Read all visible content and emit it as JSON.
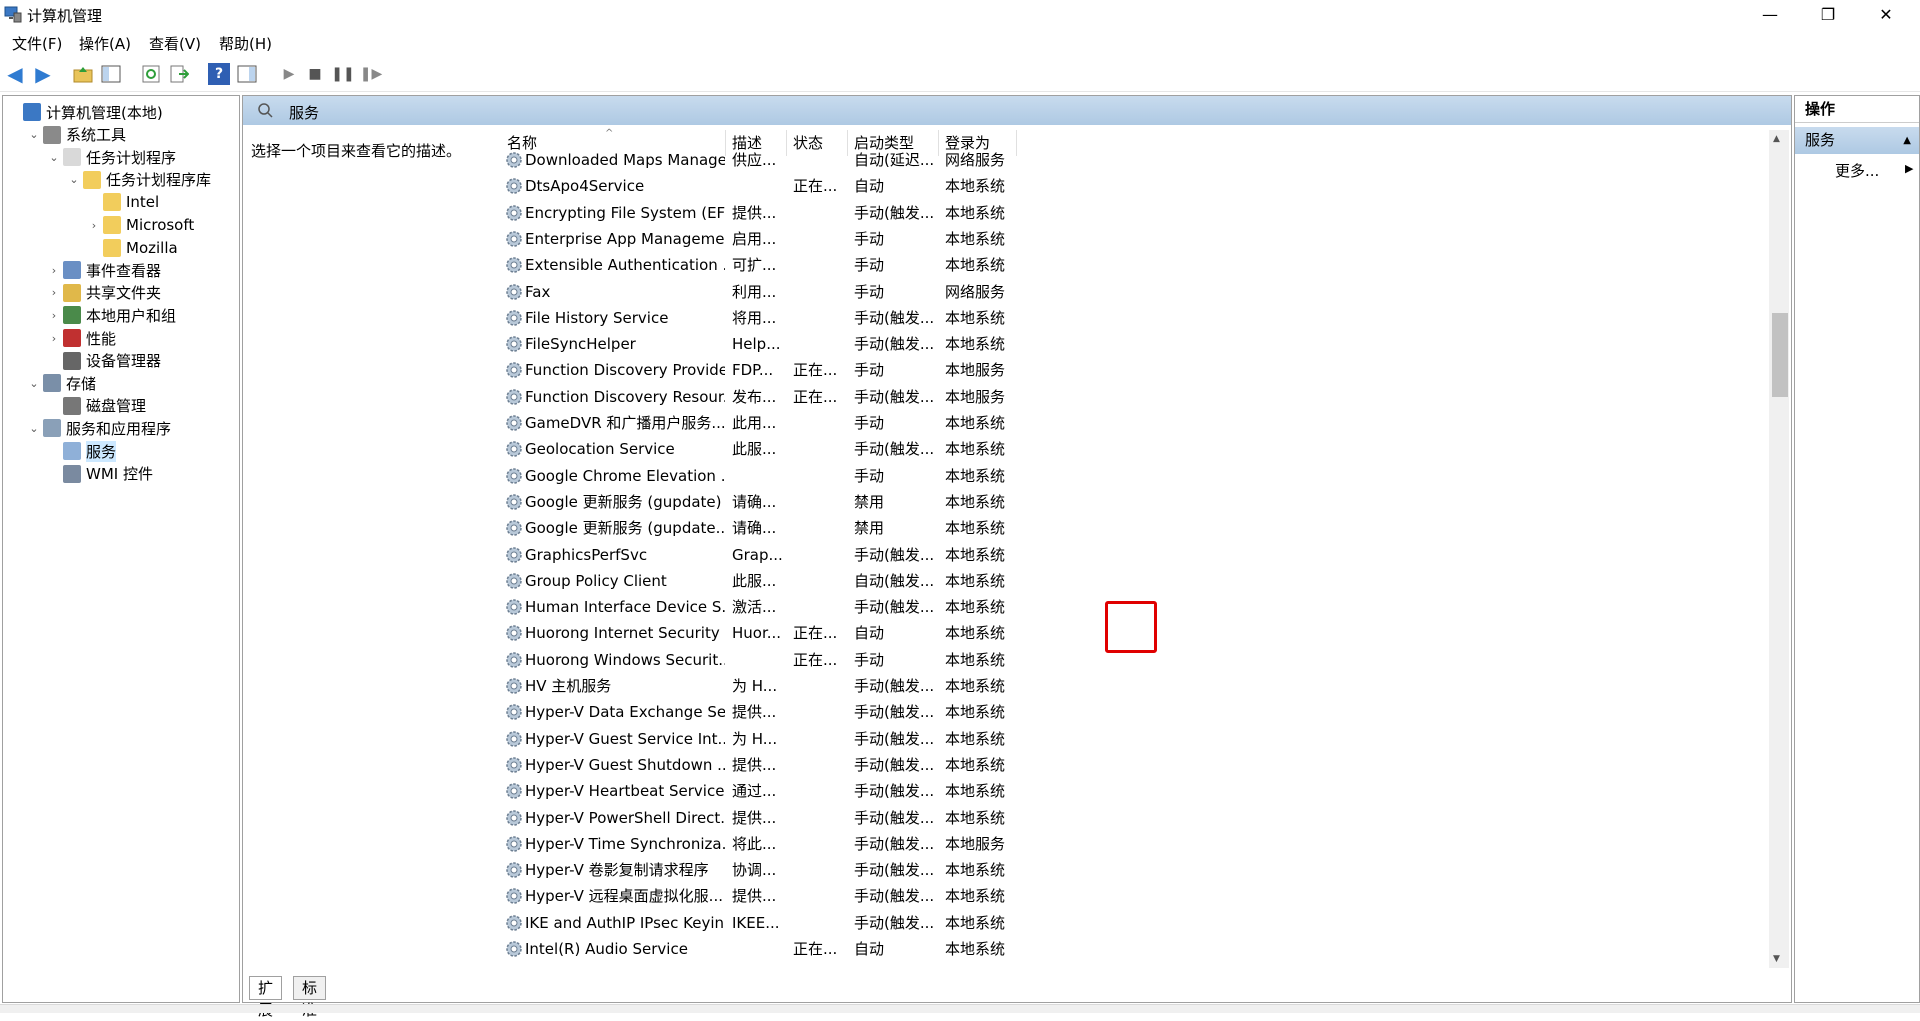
{
  "window": {
    "title": "计算机管理"
  },
  "menu": [
    "文件(F)",
    "操作(A)",
    "查看(V)",
    "帮助(H)"
  ],
  "tree": [
    {
      "label": "计算机管理(本地)",
      "expander": "",
      "level": 0,
      "icon": "computer-management-icon"
    },
    {
      "label": "系统工具",
      "expander": "⌄",
      "level": 1,
      "icon": "tools-icon"
    },
    {
      "label": "任务计划程序",
      "expander": "⌄",
      "level": 2,
      "icon": "clock-icon"
    },
    {
      "label": "任务计划程序库",
      "expander": "⌄",
      "level": 3,
      "icon": "folder-icon"
    },
    {
      "label": "Intel",
      "expander": "",
      "level": 4,
      "icon": "folder-icon"
    },
    {
      "label": "Microsoft",
      "expander": "›",
      "level": 4,
      "icon": "folder-icon"
    },
    {
      "label": "Mozilla",
      "expander": "",
      "level": 4,
      "icon": "folder-icon"
    },
    {
      "label": "事件查看器",
      "expander": "›",
      "level": 2,
      "icon": "event-viewer-icon"
    },
    {
      "label": "共享文件夹",
      "expander": "›",
      "level": 2,
      "icon": "shared-folder-icon"
    },
    {
      "label": "本地用户和组",
      "expander": "›",
      "level": 2,
      "icon": "users-icon"
    },
    {
      "label": "性能",
      "expander": "›",
      "level": 2,
      "icon": "performance-icon"
    },
    {
      "label": "设备管理器",
      "expander": "",
      "level": 2,
      "icon": "device-manager-icon"
    },
    {
      "label": "存储",
      "expander": "⌄",
      "level": 1,
      "icon": "storage-icon"
    },
    {
      "label": "磁盘管理",
      "expander": "",
      "level": 2,
      "icon": "disk-icon"
    },
    {
      "label": "服务和应用程序",
      "expander": "⌄",
      "level": 1,
      "icon": "services-apps-icon"
    },
    {
      "label": "服务",
      "expander": "",
      "level": 2,
      "icon": "services-icon",
      "selected": true
    },
    {
      "label": "WMI 控件",
      "expander": "",
      "level": 2,
      "icon": "wmi-icon"
    }
  ],
  "center": {
    "title": "服务",
    "description_hint": "选择一个项目来查看它的描述。",
    "columns": [
      "名称",
      "描述",
      "状态",
      "启动类型",
      "登录为"
    ],
    "tabs": [
      "扩展",
      "标准"
    ],
    "services": [
      [
        "Downloaded Maps Manager",
        "供应...",
        "",
        "自动(延迟...",
        "网络服务"
      ],
      [
        "DtsApo4Service",
        "",
        "正在...",
        "自动",
        "本地系统"
      ],
      [
        "Encrypting File System (EFS)",
        "提供...",
        "",
        "手动(触发...",
        "本地系统"
      ],
      [
        "Enterprise App Manageme...",
        "启用...",
        "",
        "手动",
        "本地系统"
      ],
      [
        "Extensible Authentication ...",
        "可扩...",
        "",
        "手动",
        "本地系统"
      ],
      [
        "Fax",
        "利用...",
        "",
        "手动",
        "网络服务"
      ],
      [
        "File History Service",
        "将用...",
        "",
        "手动(触发...",
        "本地系统"
      ],
      [
        "FileSyncHelper",
        "Help...",
        "",
        "手动(触发...",
        "本地系统"
      ],
      [
        "Function Discovery Provide...",
        "FDP...",
        "正在...",
        "手动",
        "本地服务"
      ],
      [
        "Function Discovery Resour...",
        "发布...",
        "正在...",
        "手动(触发...",
        "本地服务"
      ],
      [
        "GameDVR 和广播用户服务...",
        "此用...",
        "",
        "手动",
        "本地系统"
      ],
      [
        "Geolocation Service",
        "此服...",
        "",
        "手动(触发...",
        "本地系统"
      ],
      [
        "Google Chrome Elevation ...",
        "",
        "",
        "手动",
        "本地系统"
      ],
      [
        "Google 更新服务 (gupdate)",
        "请确...",
        "",
        "禁用",
        "本地系统"
      ],
      [
        "Google 更新服务 (gupdate...",
        "请确...",
        "",
        "禁用",
        "本地系统"
      ],
      [
        "GraphicsPerfSvc",
        "Grap...",
        "",
        "手动(触发...",
        "本地系统"
      ],
      [
        "Group Policy Client",
        "此服...",
        "",
        "自动(触发...",
        "本地系统"
      ],
      [
        "Human Interface Device S...",
        "激活...",
        "",
        "手动(触发...",
        "本地系统"
      ],
      [
        "Huorong Internet Security ...",
        "Huor...",
        "正在...",
        "自动",
        "本地系统"
      ],
      [
        "Huorong Windows Securit...",
        "",
        "正在...",
        "手动",
        "本地系统"
      ],
      [
        "HV 主机服务",
        "为 H...",
        "",
        "手动(触发...",
        "本地系统"
      ],
      [
        "Hyper-V Data Exchange Se...",
        "提供...",
        "",
        "手动(触发...",
        "本地系统"
      ],
      [
        "Hyper-V Guest Service Int...",
        "为 H...",
        "",
        "手动(触发...",
        "本地系统"
      ],
      [
        "Hyper-V Guest Shutdown ...",
        "提供...",
        "",
        "手动(触发...",
        "本地系统"
      ],
      [
        "Hyper-V Heartbeat Service",
        "通过...",
        "",
        "手动(触发...",
        "本地系统"
      ],
      [
        "Hyper-V PowerShell Direct...",
        "提供...",
        "",
        "手动(触发...",
        "本地系统"
      ],
      [
        "Hyper-V Time Synchroniza...",
        "将此...",
        "",
        "手动(触发...",
        "本地服务"
      ],
      [
        "Hyper-V 卷影复制请求程序",
        "协调...",
        "",
        "手动(触发...",
        "本地系统"
      ],
      [
        "Hyper-V 远程桌面虚拟化服...",
        "提供...",
        "",
        "手动(触发...",
        "本地系统"
      ],
      [
        "IKE and AuthIP IPsec Keyin...",
        "IKEE...",
        "",
        "手动(触发...",
        "本地系统"
      ],
      [
        "Intel(R) Audio Service",
        "",
        "正在...",
        "自动",
        "本地系统"
      ]
    ]
  },
  "actions": {
    "title": "操作",
    "section": "服务",
    "more": "更多..."
  },
  "colors": {
    "header_blue": "#aec9e3",
    "highlight_red": "#e00000",
    "selection": "#cce8ff"
  }
}
